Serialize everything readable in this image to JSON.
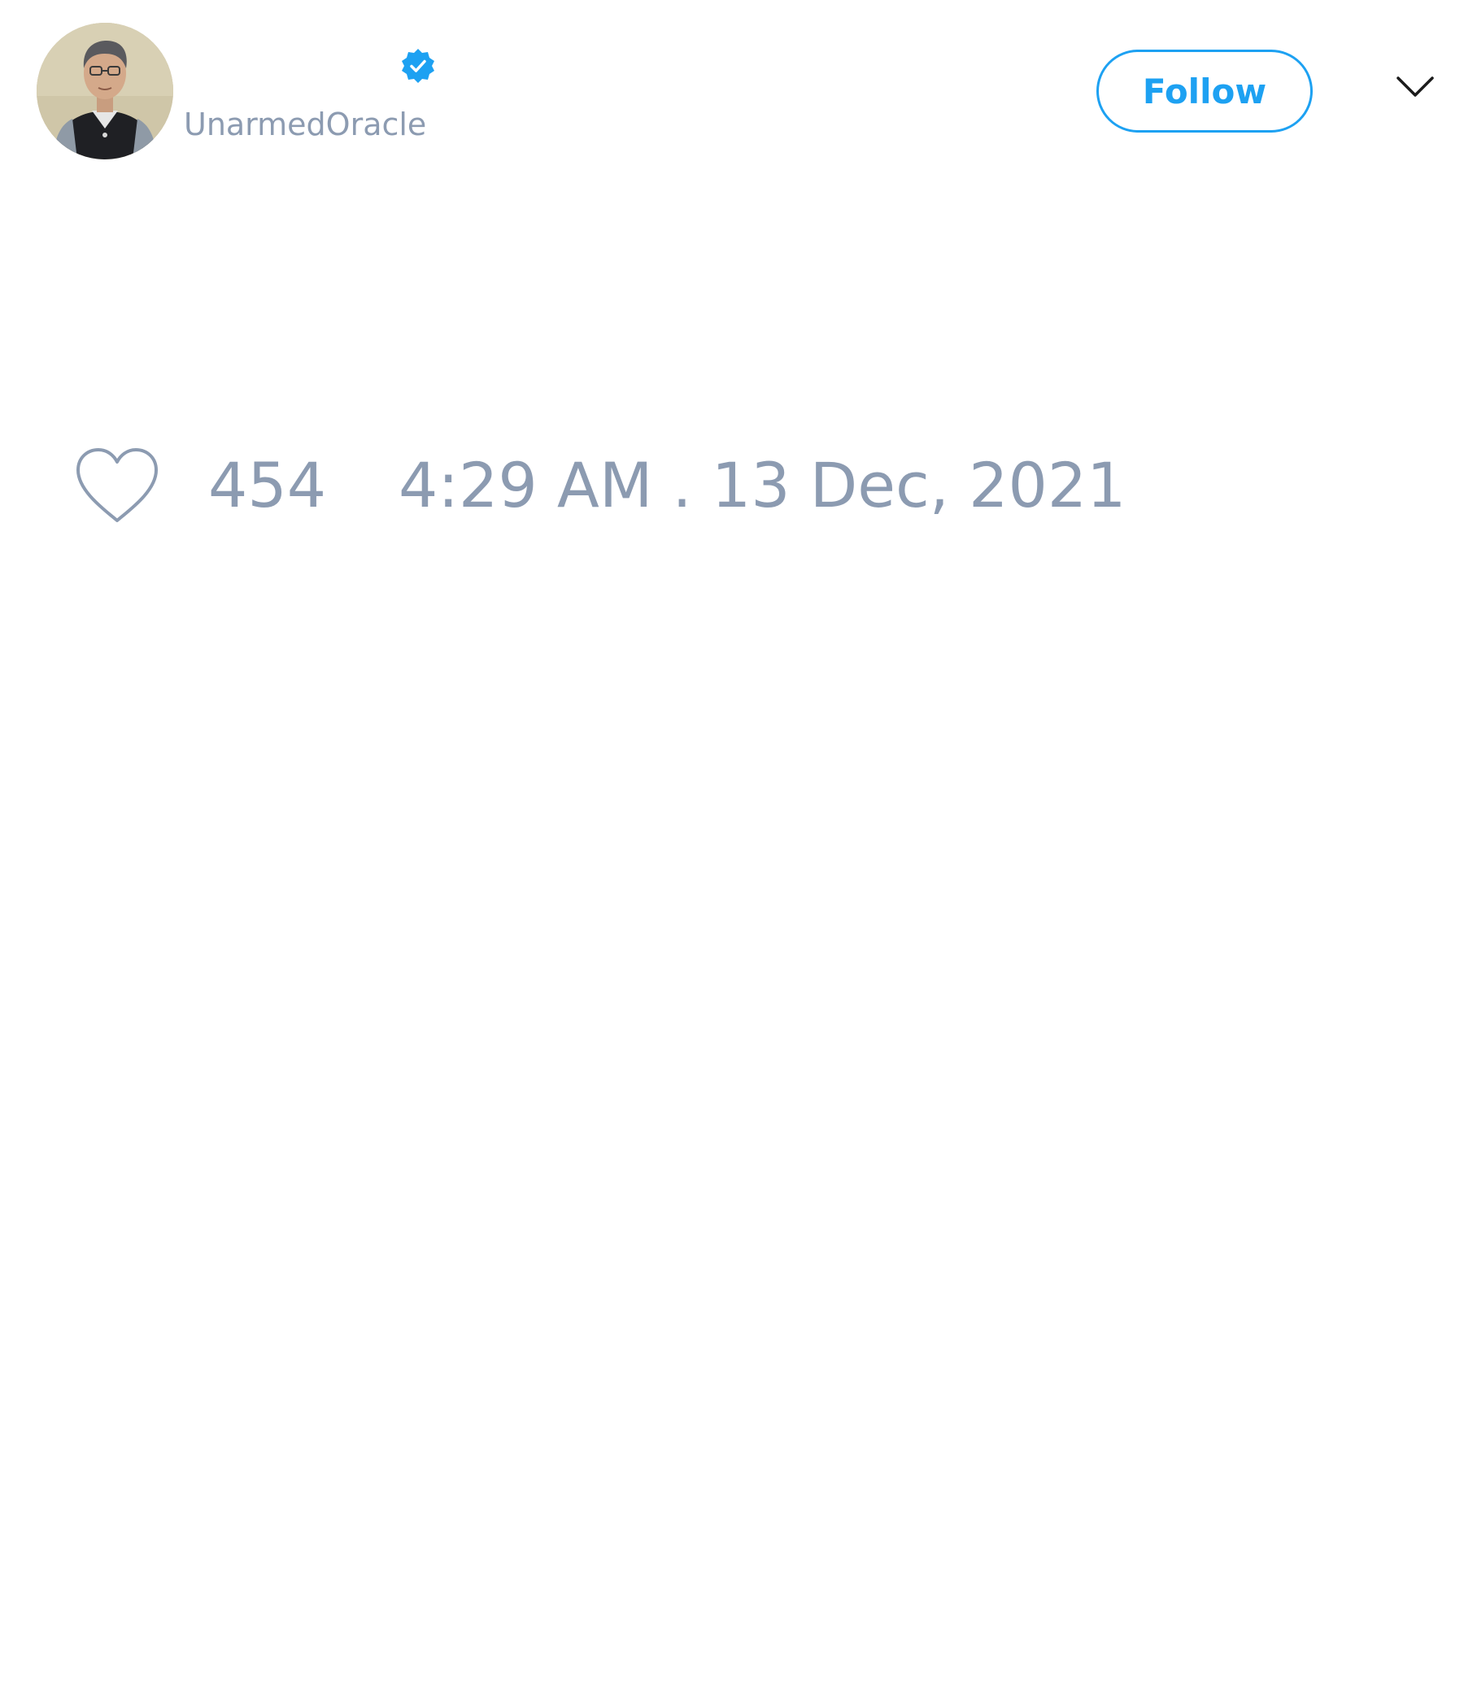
{
  "tweet": {
    "author": {
      "handle": "UnarmedOracle",
      "verified": true,
      "avatar_icon": "portrait-avatar"
    },
    "follow_label": "Follow",
    "menu_icon": "chevron-down-icon",
    "likes": {
      "icon": "heart-outline-icon",
      "count": "454"
    },
    "timestamp": "4:29 AM . 13 Dec, 2021"
  },
  "colors": {
    "accent": "#1da1f2",
    "muted_text": "#8c9bb1",
    "background": "#ffffff"
  }
}
